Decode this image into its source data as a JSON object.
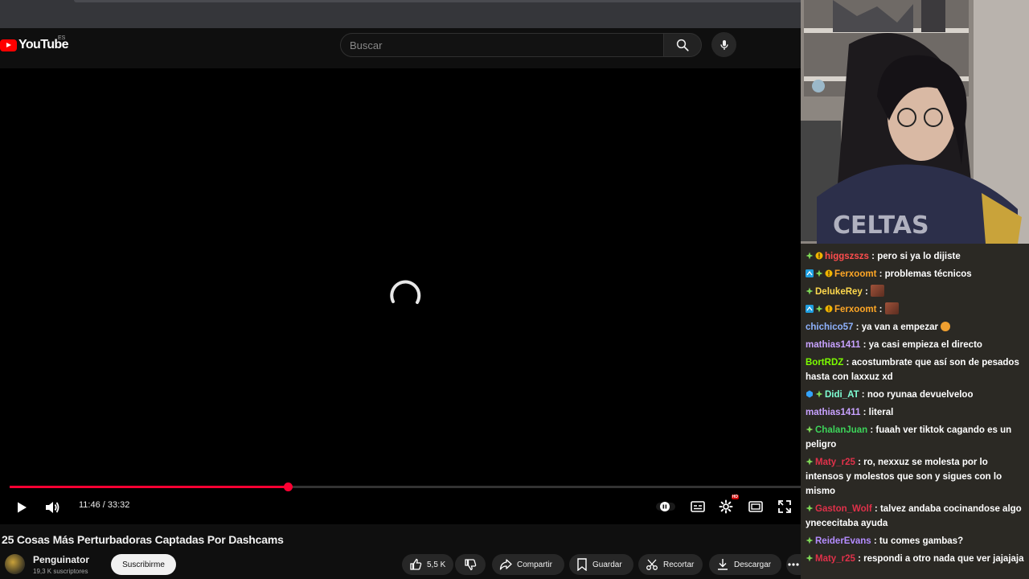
{
  "youtube": {
    "logo_text": "YouTube",
    "region": "ES",
    "search_placeholder": "Buscar",
    "time": "11:46 / 33:32",
    "progress_fraction": 0.352,
    "video_title": "25 Cosas Más Perturbadoras Captadas Por Dashcams",
    "channel_name": "Penguinator",
    "channel_subs": "19,3 K suscriptores",
    "subscribe_label": "Suscribirme",
    "likes": "5,5 K",
    "share_label": "Compartir",
    "save_label": "Guardar",
    "clip_label": "Recortar",
    "download_label": "Descargar",
    "accent_color": "#ff0033"
  },
  "chat": {
    "messages": [
      {
        "user": "higgszszs",
        "color": "#ff4d4d",
        "badges": [
          "plus-badge",
          "bits-badge"
        ],
        "text": "pero si ya lo dijiste"
      },
      {
        "user": "Ferxoomt",
        "color": "#ffa726",
        "badges": [
          "prime-badge",
          "plus-badge",
          "bits-badge"
        ],
        "text": "problemas técnicos"
      },
      {
        "user": "DelukeRey",
        "color": "#ffd84d",
        "badges": [
          "plus-badge"
        ],
        "text": "",
        "emote": true
      },
      {
        "user": "Ferxoomt",
        "color": "#ffa726",
        "badges": [
          "prime-badge",
          "plus-badge",
          "bits-badge"
        ],
        "text": "",
        "emote": true
      },
      {
        "user": "chichico57",
        "color": "#8fb3ff",
        "badges": [],
        "text": "ya van a empezar",
        "emoji": true
      },
      {
        "user": "mathias1411",
        "color": "#c8a2ff",
        "badges": [],
        "text": "ya casi empieza el directo"
      },
      {
        "user": "BortRDZ",
        "color": "#7cfc00",
        "badges": [],
        "text": "acostumbrate que así son de pesados hasta con laxxuz xd"
      },
      {
        "user": "Didi_AT",
        "color": "#7fffd4",
        "badges": [
          "gem-badge",
          "plus-badge"
        ],
        "text": "noo ryunaa devuelveloo"
      },
      {
        "user": "mathias1411",
        "color": "#c8a2ff",
        "badges": [],
        "text": "literal"
      },
      {
        "user": "ChalanJuan",
        "color": "#3cd45a",
        "badges": [
          "plus-badge"
        ],
        "text": "fuaah ver tiktok cagando es un peligro"
      },
      {
        "user": "Maty_r25",
        "color": "#e0314a",
        "badges": [
          "plus-badge"
        ],
        "text": "ro, nexxuz se molesta por lo intensos y molestos que son y sigues con lo mismo"
      },
      {
        "user": "Gaston_Wolf",
        "color": "#e0314a",
        "badges": [
          "plus-badge"
        ],
        "text": "talvez andaba cocinandose algo ynececitaba ayuda"
      },
      {
        "user": "ReiderEvans",
        "color": "#b48cff",
        "badges": [
          "plus-badge"
        ],
        "text": "tu comes gambas?"
      },
      {
        "user": "Maty_r25",
        "color": "#e0314a",
        "badges": [
          "plus-badge"
        ],
        "text": "respondi a otro nada que ver jajajaja"
      }
    ]
  }
}
